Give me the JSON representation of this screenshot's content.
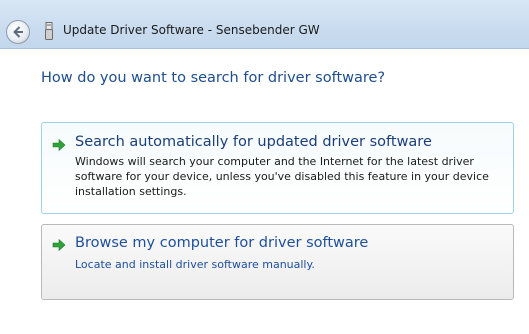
{
  "window": {
    "title": "Update Driver Software - Sensebender GW"
  },
  "icons": {
    "back": "back-arrow-icon",
    "device": "usb-device-icon",
    "option_arrow": "green-arrow-icon"
  },
  "page": {
    "heading": "How do you want to search for driver software?"
  },
  "options": [
    {
      "title": "Search automatically for updated driver software",
      "description": "Windows will search your computer and the Internet for the latest driver software for your device, unless you've disabled this feature in your device installation settings."
    },
    {
      "title": "Browse my computer for driver software",
      "description": "Locate and install driver software manually."
    }
  ],
  "colors": {
    "heading": "#1e4e8c",
    "option_auto_border": "#9ed0e6",
    "option_browse_border": "#b9b9b9",
    "arrow_green": "#2fa33a"
  }
}
